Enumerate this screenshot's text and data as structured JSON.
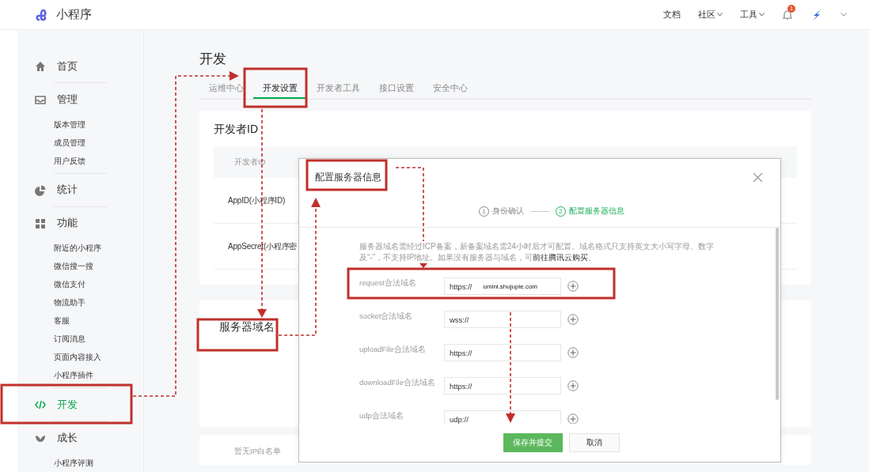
{
  "app": {
    "name": "小程序"
  },
  "top_nav": [
    {
      "label": "文档",
      "dropdown": false
    },
    {
      "label": "社区",
      "dropdown": true
    },
    {
      "label": "工具",
      "dropdown": true
    }
  ],
  "notifications": {
    "badge": "1"
  },
  "sidebar": {
    "groups": [
      {
        "label": "首页",
        "selected": false
      },
      {
        "label": "管理",
        "selected": false,
        "items": [
          {
            "label": "版本管理",
            "selected": false
          },
          {
            "label": "成员管理",
            "selected": false
          },
          {
            "label": "用户反馈",
            "selected": false
          }
        ]
      },
      {
        "label": "统计",
        "selected": false
      },
      {
        "label": "功能",
        "selected": false,
        "items": [
          {
            "label": "附近的小程序",
            "selected": false
          },
          {
            "label": "微信搜一搜",
            "selected": false
          },
          {
            "label": "微信支付",
            "selected": false
          },
          {
            "label": "物流助手",
            "selected": false
          },
          {
            "label": "客服",
            "selected": false
          },
          {
            "label": "订阅消息",
            "selected": false
          },
          {
            "label": "页面内容接入",
            "selected": false
          },
          {
            "label": "小程序插件",
            "selected": false
          }
        ]
      },
      {
        "label": "开发",
        "selected": true
      },
      {
        "label": "成长",
        "selected": false,
        "items": [
          {
            "label": "小程序评测",
            "selected": false
          }
        ]
      }
    ]
  },
  "page": {
    "title": "开发"
  },
  "tabs": [
    {
      "label": "运维中心",
      "selected": false
    },
    {
      "label": "开发设置",
      "selected": true
    },
    {
      "label": "开发者工具",
      "selected": false
    },
    {
      "label": "接口设置",
      "selected": false
    },
    {
      "label": "安全中心",
      "selected": false
    }
  ],
  "developer_id": {
    "title": "开发者ID",
    "header": "开发者ID",
    "rows": [
      "AppID(小程序ID)",
      "AppSecret(小程序密"
    ]
  },
  "server_domain": {
    "title": "服务器域名"
  },
  "ip_whitelist": {
    "empty_text": "暂无IP白名单"
  },
  "dialog": {
    "title": "配置服务器信息",
    "steps": [
      {
        "number": "1",
        "label": "身份确认",
        "selected": false
      },
      {
        "number": "2",
        "label": "配置服务器信息",
        "selected": true
      }
    ],
    "intro": "服务器域名需经过ICP备案，新备案域名需24小时后才可配置。域名格式只支持英文大小写字母、数字及“-”，不支持IP地址。如果没有服务器与域名，可",
    "intro_link": "前往腾讯云购买",
    "intro_end": "。",
    "fields": [
      {
        "label": "request合法域名",
        "prefix": "https://",
        "value": "umini.shujupie.com"
      },
      {
        "label": "socket合法域名",
        "prefix": "wss://"
      },
      {
        "label": "uploadFile合法域名",
        "prefix": "https://"
      },
      {
        "label": "downloadFile合法域名",
        "prefix": "https://"
      },
      {
        "label": "udp合法域名",
        "prefix": "udp://"
      }
    ],
    "primary_button": "保存并提交",
    "secondary_button": "取消"
  }
}
